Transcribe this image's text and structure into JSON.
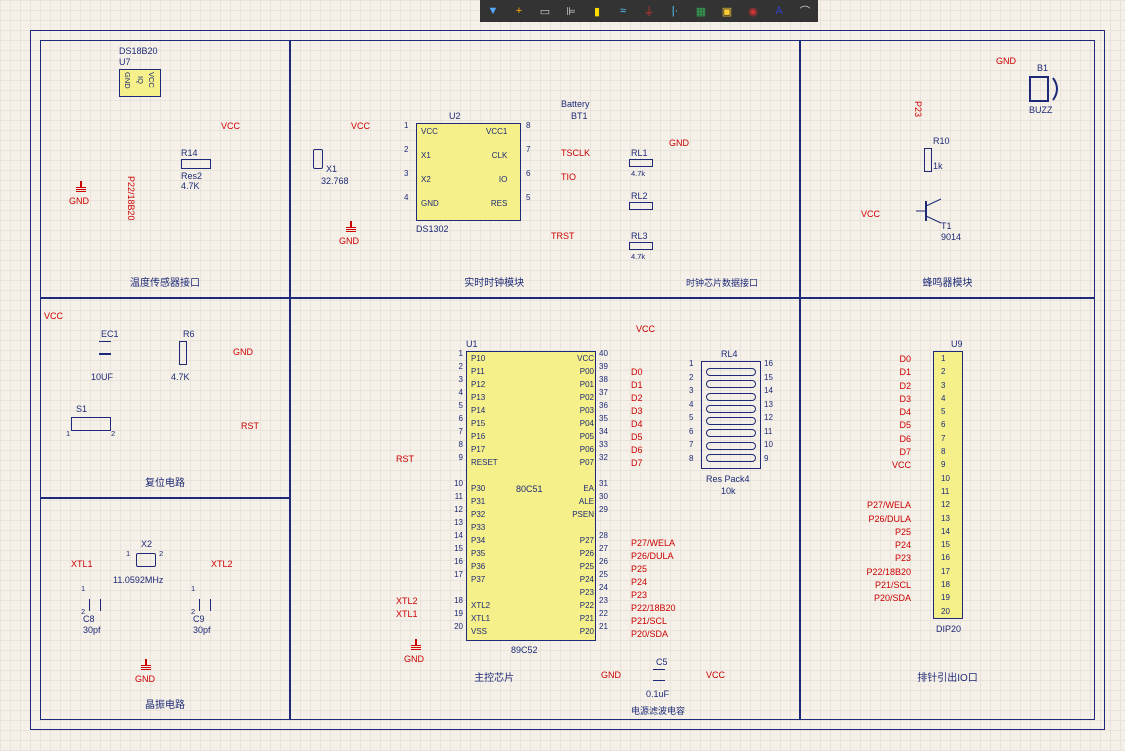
{
  "toolbar": {
    "icons": [
      "filter",
      "crosshair",
      "rect",
      "align",
      "chip",
      "wave",
      "gnd",
      "ruler",
      "render",
      "note",
      "circle-a",
      "letter-a",
      "arc"
    ]
  },
  "modules": {
    "temp_sensor": {
      "title": "温度传感器接口",
      "comp": "DS18B20",
      "ref": "U7",
      "res": "R14",
      "res_type": "Res2",
      "res_val": "4.7K",
      "net": "P22/18B20",
      "pins": [
        "GND",
        "IQ",
        "VCC"
      ]
    },
    "rtc": {
      "title": "实时时钟模块",
      "comp": "DS1302",
      "ref": "U2",
      "xtal_ref": "X1",
      "xtal_val": "32.768",
      "bat": "Battery",
      "bat_ref": "BT1",
      "pins_l": [
        "VCC",
        "X1",
        "X2",
        "GND"
      ],
      "pins_r": [
        "VCC1",
        "CLK",
        "IO",
        "RES"
      ],
      "pn_l": [
        "1",
        "2",
        "3",
        "4"
      ],
      "pn_r": [
        "8",
        "7",
        "6",
        "5"
      ],
      "nets": [
        "TSCLK",
        "TIO",
        "TRST"
      ],
      "rl": [
        "RL1",
        "RL2",
        "RL3"
      ],
      "rl_val": "4.7k",
      "data_title": "时钟芯片数据接口"
    },
    "buzzer": {
      "title": "蜂鸣器模块",
      "buzz": "BUZZ",
      "buzz_ref": "B1",
      "res": "R10",
      "res_val": "1k",
      "trans": "T1",
      "trans_type": "9014",
      "net": "P23"
    },
    "reset": {
      "title": "复位电路",
      "cap": "EC1",
      "cap_val": "10UF",
      "res": "R6",
      "res_val": "4.7K",
      "sw": "S1",
      "net": "RST"
    },
    "xtal": {
      "title": "晶振电路",
      "xtal": "X2",
      "freq": "11.0592MHz",
      "c1": "C8",
      "c2": "C9",
      "c_val": "30pf",
      "xtl1": "XTL1",
      "xtl2": "XTL2"
    },
    "mcu": {
      "title": "主控芯片",
      "ref": "U1",
      "part": "89C52",
      "core": "80C51",
      "pL": [
        "P10",
        "P11",
        "P12",
        "P13",
        "P14",
        "P15",
        "P16",
        "P17",
        "RESET",
        "",
        "P30",
        "P31",
        "P32",
        "P33",
        "P34",
        "P35",
        "P36",
        "P37",
        "",
        "XTL2",
        "XTL1",
        "VSS"
      ],
      "pnL": [
        "1",
        "2",
        "3",
        "4",
        "5",
        "6",
        "7",
        "8",
        "9",
        "",
        "10",
        "11",
        "12",
        "13",
        "14",
        "15",
        "16",
        "17",
        "",
        "18",
        "19",
        "20"
      ],
      "pR": [
        "VCC",
        "P00",
        "P01",
        "P02",
        "P03",
        "P04",
        "P05",
        "P06",
        "P07",
        "",
        "EA",
        "ALE",
        "PSEN",
        "",
        "P27",
        "P26",
        "P25",
        "P24",
        "P23",
        "P22",
        "P21",
        "P20"
      ],
      "pnR": [
        "40",
        "39",
        "38",
        "37",
        "36",
        "35",
        "34",
        "33",
        "32",
        "",
        "31",
        "30",
        "29",
        "",
        "28",
        "27",
        "26",
        "25",
        "24",
        "23",
        "22",
        "21"
      ],
      "nR1": [
        "",
        "D0",
        "D1",
        "D2",
        "D3",
        "D4",
        "D5",
        "D6",
        "D7"
      ],
      "nR2": [
        "P27/WELA",
        "P26/DULA",
        "P25",
        "P24",
        "P23",
        "P22/18B20",
        "P21/SCL",
        "P20/SDA"
      ],
      "xtl1": "XTL1",
      "xtl2": "XTL2",
      "rst": "RST"
    },
    "respack": {
      "ref": "RL4",
      "type": "Res Pack4",
      "val": "10k",
      "pL": [
        "1",
        "2",
        "3",
        "4",
        "5",
        "6",
        "7",
        "8"
      ],
      "pR": [
        "16",
        "15",
        "14",
        "13",
        "12",
        "11",
        "10",
        "9"
      ]
    },
    "filter": {
      "title": "电源滤波电容",
      "ref": "C5",
      "val": "0.1uF"
    },
    "header": {
      "title": "排针引出IO口",
      "ref": "U9",
      "type": "DIP20",
      "nets": [
        "D0",
        "D1",
        "D2",
        "D3",
        "D4",
        "D5",
        "D6",
        "D7",
        "VCC",
        "",
        "",
        "P27/WELA",
        "P26/DULA",
        "P25",
        "P24",
        "P23",
        "P22/18B20",
        "P21/SCL",
        "P20/SDA",
        ""
      ],
      "pins": [
        "1",
        "2",
        "3",
        "4",
        "5",
        "6",
        "7",
        "8",
        "9",
        "10",
        "11",
        "12",
        "13",
        "14",
        "15",
        "16",
        "17",
        "18",
        "19",
        "20"
      ]
    }
  },
  "labels": {
    "vcc": "VCC",
    "gnd": "GND"
  }
}
